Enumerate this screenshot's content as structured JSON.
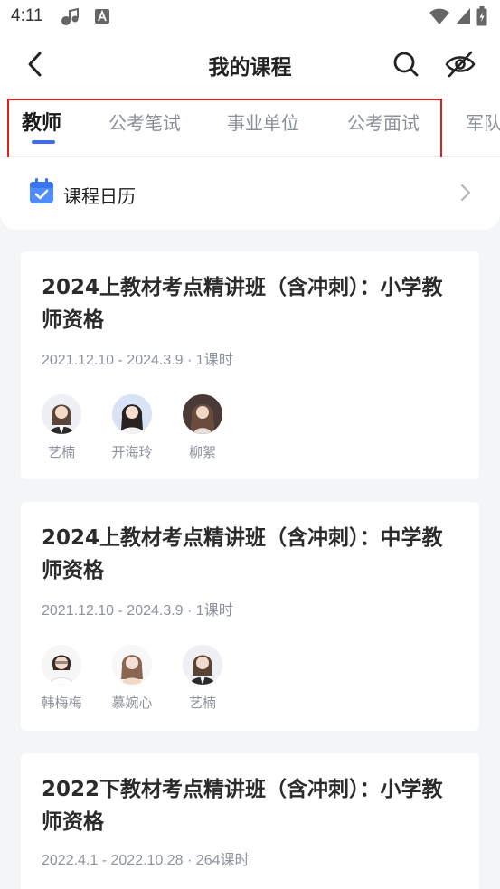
{
  "status_bar": {
    "time": "4:11",
    "left_icons": [
      "music-note-icon",
      "a-box-icon"
    ],
    "right_icons": [
      "wifi-icon",
      "signal-icon",
      "battery-icon"
    ]
  },
  "header": {
    "title": "我的课程",
    "back_icon": "chevron-left-icon",
    "search_icon": "search-icon",
    "eye_icon": "eye-off-icon"
  },
  "tabs": [
    {
      "label": "教师",
      "active": true
    },
    {
      "label": "公考笔试",
      "active": false
    },
    {
      "label": "事业单位",
      "active": false
    },
    {
      "label": "公考面试",
      "active": false
    },
    {
      "label": "军队",
      "active": false
    }
  ],
  "calendar": {
    "label": "课程日历",
    "icon": "calendar-check-icon"
  },
  "colors": {
    "accent": "#3e6bf6",
    "highlight_border": "#e02020",
    "background": "#f4f5f7"
  },
  "courses": [
    {
      "title": "2024上教材考点精讲班（含冲刺）：小学教师资格",
      "meta": "2021.12.10 - 2024.3.9 · 1课时",
      "teachers": [
        {
          "name": "艺楠"
        },
        {
          "name": "开海玲"
        },
        {
          "name": "柳絮"
        }
      ]
    },
    {
      "title": "2024上教材考点精讲班（含冲刺）：中学教师资格",
      "meta": "2021.12.10 - 2024.3.9 · 1课时",
      "teachers": [
        {
          "name": "韩梅梅"
        },
        {
          "name": "慕婉心"
        },
        {
          "name": "艺楠"
        }
      ]
    },
    {
      "title": "2022下教材考点精讲班（含冲刺）：小学教师资格",
      "meta": "2022.4.1 - 2022.10.28 · 264课时",
      "teachers": []
    }
  ]
}
